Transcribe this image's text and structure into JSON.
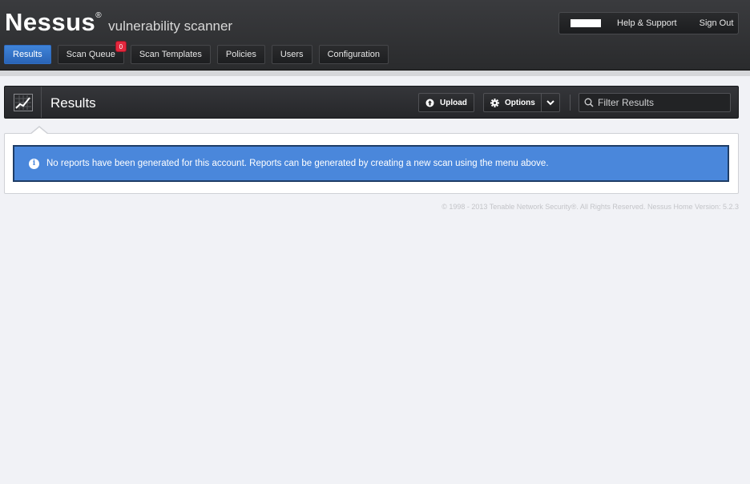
{
  "brand": {
    "name": "Nessus",
    "reg": "®",
    "tagline": "vulnerability scanner"
  },
  "nav": {
    "items": [
      {
        "label": "Results",
        "active": true
      },
      {
        "label": "Scan Queue",
        "badge": "0"
      },
      {
        "label": "Scan Templates"
      },
      {
        "label": "Policies"
      },
      {
        "label": "Users"
      },
      {
        "label": "Configuration"
      }
    ]
  },
  "topbar": {
    "help": "Help & Support",
    "signout": "Sign Out"
  },
  "results_bar": {
    "title": "Results",
    "upload_label": "Upload",
    "options_label": "Options",
    "filter_placeholder": "Filter Results"
  },
  "content": {
    "info_message": "No reports have been generated for this account. Reports can be generated by creating a new scan using the menu above."
  },
  "footer": {
    "text": "© 1998 - 2013 Tenable Network Security®. All Rights Reserved. Nessus Home Version: 5.2.3"
  },
  "colors": {
    "accent": "#3f84d9",
    "info_banner": "#4a87db",
    "badge": "#e3283e"
  }
}
